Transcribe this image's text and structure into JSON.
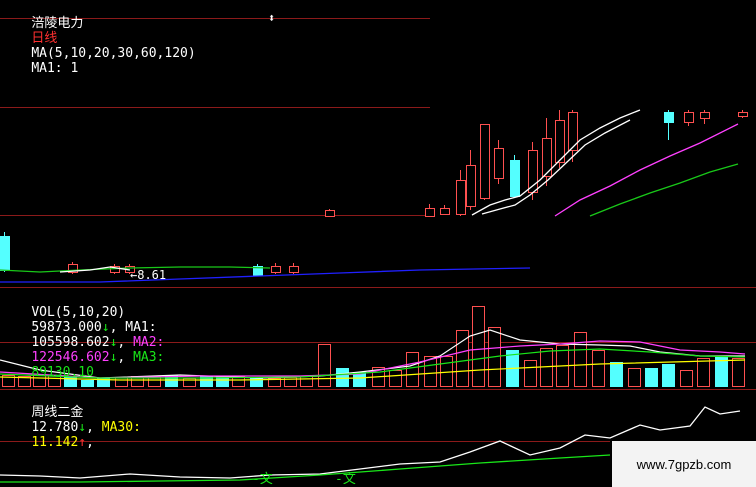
{
  "price_panel": {
    "stock_name": "涪陵电力",
    "period": "日线",
    "ma_header": "MA(5,10,20,30,60,120)",
    "ma1_prefix": "MA1: 1",
    "low_marker": "8.61"
  },
  "volume_panel": {
    "title": "VOL(5,10,20)",
    "vol_value": "59873.000",
    "vol_arrow": "↓",
    "ma1_label": "MA1:",
    "ma1_value": "105598.602",
    "ma1_arrow": "↓",
    "ma2_label": "MA2:",
    "ma2_value": "122546.602",
    "ma2_arrow": "↓",
    "ma3_label": "MA3:",
    "ma3_value": "89130.10"
  },
  "indicator_panel": {
    "title": "周线二金",
    "value": "12.780",
    "value_arrow": "↓",
    "ma30_label": "MA30:",
    "ma30_value": "11.142",
    "ma30_arrow": "↑"
  },
  "watermark": "www.7gpzb.com",
  "colors": {
    "background": "#000000",
    "up_candle": "#ff5050",
    "down_candle": "#54ffff",
    "ma_white": "#ffffff",
    "ma_magenta": "#ff40ff",
    "ma_green": "#19c819",
    "ma_blue": "#2020ff",
    "grid_red": "#8b1a1a"
  }
}
